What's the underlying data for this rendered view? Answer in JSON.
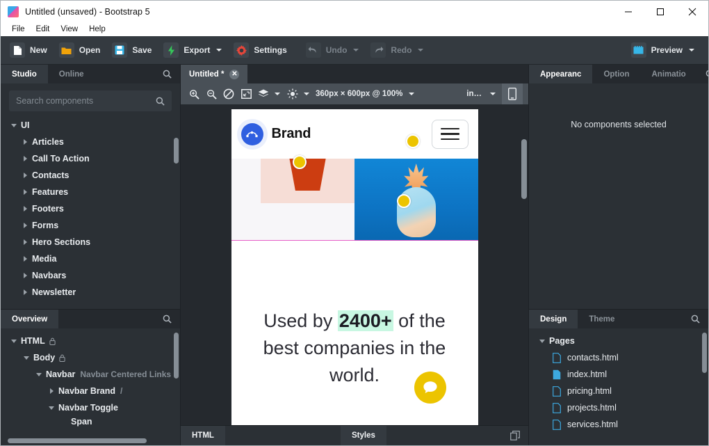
{
  "window": {
    "title": "Untitled (unsaved) - Bootstrap 5",
    "app_icon": "app-logo-icon",
    "minimize": "minimize-icon",
    "maximize": "maximize-icon",
    "close": "close-icon"
  },
  "menubar": {
    "items": [
      "File",
      "Edit",
      "View",
      "Help"
    ]
  },
  "toolbar": {
    "new_label": "New",
    "open_label": "Open",
    "save_label": "Save",
    "export_label": "Export",
    "settings_label": "Settings",
    "undo_label": "Undo",
    "redo_label": "Redo",
    "preview_label": "Preview"
  },
  "left_panel": {
    "tabs": [
      {
        "label": "Studio",
        "active": true
      },
      {
        "label": "Online",
        "active": false
      }
    ],
    "search_icon": "search-icon",
    "search": {
      "placeholder": "Search components",
      "value": ""
    },
    "tree": [
      {
        "label": "UI",
        "level": 1,
        "expanded": true
      },
      {
        "label": "Articles",
        "level": 2,
        "expanded": false
      },
      {
        "label": "Call To Action",
        "level": 2,
        "expanded": false
      },
      {
        "label": "Contacts",
        "level": 2,
        "expanded": false
      },
      {
        "label": "Features",
        "level": 2,
        "expanded": false
      },
      {
        "label": "Footers",
        "level": 2,
        "expanded": false
      },
      {
        "label": "Forms",
        "level": 2,
        "expanded": false
      },
      {
        "label": "Hero Sections",
        "level": 2,
        "expanded": false
      },
      {
        "label": "Media",
        "level": 2,
        "expanded": false
      },
      {
        "label": "Navbars",
        "level": 2,
        "expanded": false
      },
      {
        "label": "Newsletter",
        "level": 2,
        "expanded": false
      }
    ]
  },
  "overview_panel": {
    "tab_label": "Overview",
    "search_icon": "search-icon",
    "rows": [
      {
        "label": "HTML",
        "sub": "",
        "indent": 14,
        "arrow": "down",
        "lock": true
      },
      {
        "label": "Body",
        "sub": "",
        "indent": 32,
        "arrow": "down",
        "lock": true
      },
      {
        "label": "Navbar",
        "sub": "Navbar Centered Links",
        "indent": 50,
        "arrow": "down",
        "lock": false
      },
      {
        "label": "Navbar Brand",
        "sub": "/",
        "indent": 68,
        "arrow": "right",
        "lock": false
      },
      {
        "label": "Navbar Toggle",
        "sub": "",
        "indent": 68,
        "arrow": "down",
        "lock": false
      },
      {
        "label": "Span",
        "sub": "",
        "indent": 86,
        "arrow": "blank",
        "lock": false
      }
    ]
  },
  "document_tab": {
    "title": "Untitled *",
    "close_icon": "close-icon"
  },
  "canvas_toolbar": {
    "icons": [
      "zoom-in-icon",
      "zoom-out-icon",
      "disable-icon",
      "fit-screen-icon",
      "layers-icon",
      "brightness-icon"
    ],
    "size_label": "360px × 600px @ 100%",
    "unit_label": "in…",
    "device_icon": "mobile-device-icon"
  },
  "preview": {
    "brand": "Brand",
    "logo_icon": "pen-tool-icon",
    "menu_icon": "hamburger-menu-icon",
    "headline_before": "Used by ",
    "headline_highlight": "2400+",
    "headline_after": " of the best companies in the world.",
    "chat_fab_icon": "chat-bubble-icon",
    "add_fab_icon": "plus-icon",
    "highlight_color": "#c8f7e2",
    "marker_color": "#ecc400",
    "add_fab_color": "#1b86da"
  },
  "statusbar": {
    "html_tab": "HTML",
    "styles_tab": "Styles",
    "duplicate_icon": "duplicate-icon"
  },
  "right_panel": {
    "tabs": [
      {
        "label": "Appearanc",
        "active": true
      },
      {
        "label": "Option",
        "active": false
      },
      {
        "label": "Animatio",
        "active": false
      }
    ],
    "search_icon": "search-icon",
    "empty_message": "No components selected"
  },
  "design_panel": {
    "tabs": [
      {
        "label": "Design",
        "active": true
      },
      {
        "label": "Theme",
        "active": false
      }
    ],
    "search_icon": "search-icon",
    "group_label": "Pages",
    "files": [
      {
        "name": "contacts.html",
        "active": false
      },
      {
        "name": "index.html",
        "active": true
      },
      {
        "name": "pricing.html",
        "active": false
      },
      {
        "name": "projects.html",
        "active": false
      },
      {
        "name": "services.html",
        "active": false
      }
    ]
  }
}
